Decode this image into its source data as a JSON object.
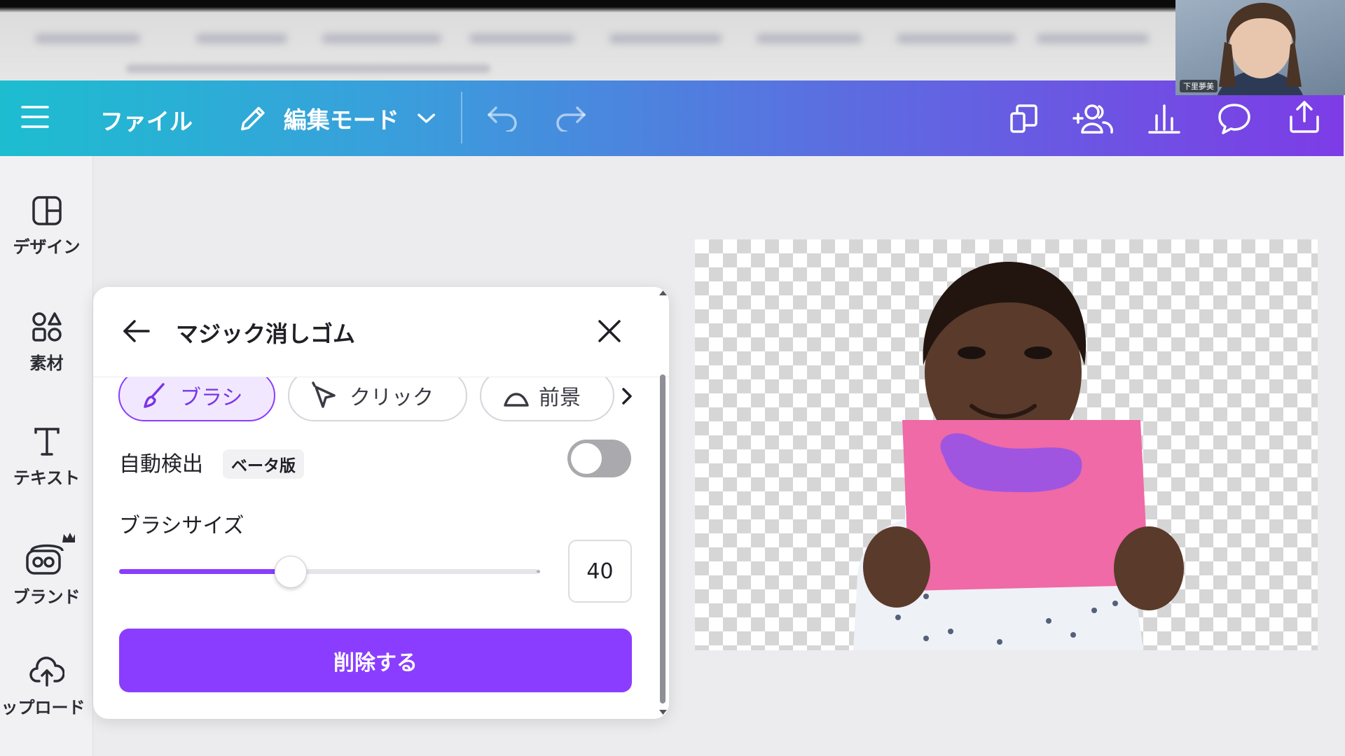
{
  "toolbar": {
    "file_label": "ファイル",
    "edit_mode_label": "編集モード"
  },
  "sidebar": {
    "items": [
      {
        "label": "デザイン",
        "icon": "design-layout-icon"
      },
      {
        "label": "素材",
        "icon": "elements-icon"
      },
      {
        "label": "テキスト",
        "icon": "text-icon"
      },
      {
        "label": "ブランド",
        "icon": "brand-icon"
      },
      {
        "label": "ップロード",
        "icon": "upload-cloud-icon"
      }
    ]
  },
  "panel": {
    "title": "マジック消しゴム",
    "modes": [
      "ブラシ",
      "クリック",
      "前景"
    ],
    "auto_detect_label": "自動検出",
    "beta_label": "ベータ版",
    "auto_detect_on": false,
    "brush_size_label": "ブラシサイズ",
    "brush_size": "40",
    "brush_size_fraction": 0.33,
    "delete_label": "削除する"
  },
  "webcam": {
    "name": "下里夢美"
  },
  "colors": {
    "accent": "#8b3dff",
    "toolbar_start": "#1dbdd0",
    "toolbar_end": "#7d3ce6"
  }
}
